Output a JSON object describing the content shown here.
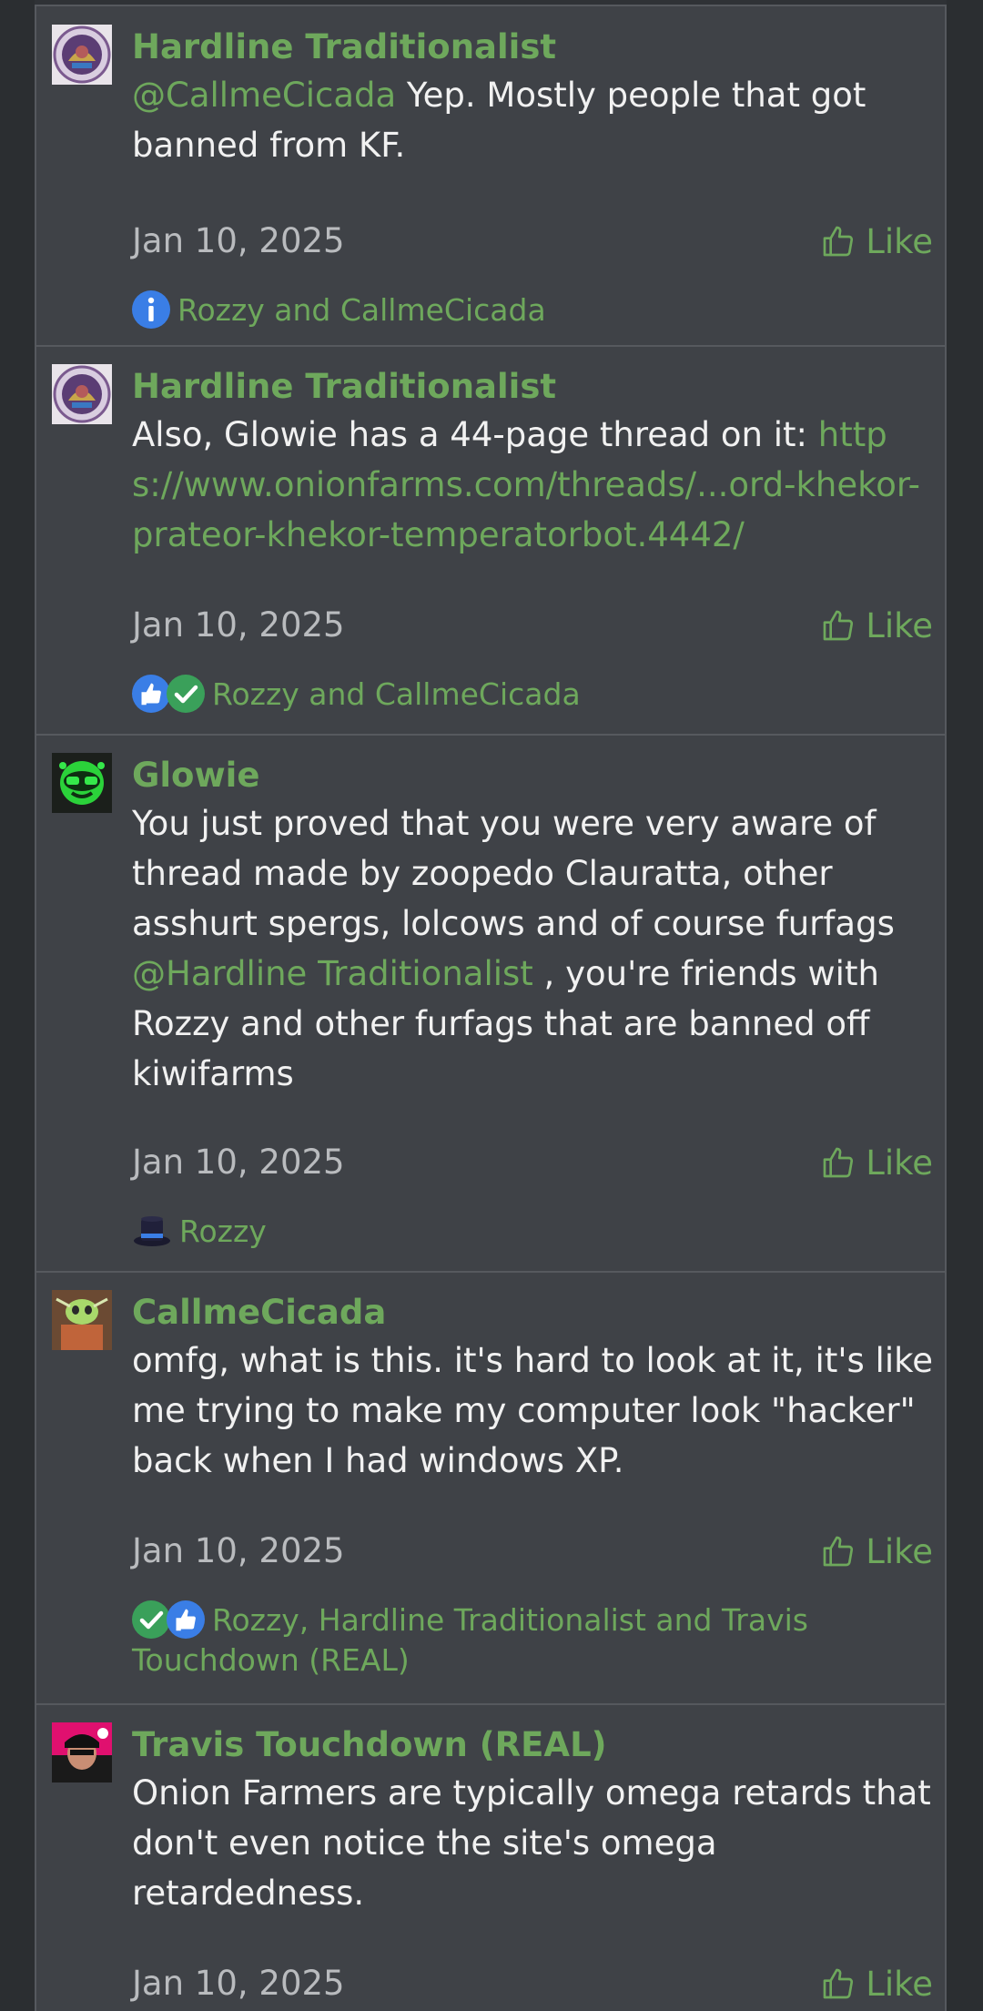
{
  "colors": {
    "background": "#2f3236",
    "post_bg": "#3f4247",
    "accent": "#6ea85c",
    "travis": "#6ea85c",
    "text": "#f1f1f1",
    "muted": "#b9bbbe"
  },
  "posts": [
    {
      "username": "Hardline Traditionalist",
      "avatar_icon": "seal-avatar",
      "body": {
        "mention": "@CallmeCicada",
        "text": " Yep. Mostly people that got banned from KF."
      },
      "date": "Jan 10, 2025",
      "like_label": "Like",
      "reaction_icons": [
        "info-icon"
      ],
      "reactions": "Rozzy and CallmeCicada"
    },
    {
      "username": "Hardline Traditionalist",
      "avatar_icon": "seal-avatar",
      "body": {
        "text": "Also, Glowie has a 44-page thread on it: ",
        "link": "https://www.onionfarms.com/threads/...ord-khekor-prateor-khekor-temperatorbot.4442/"
      },
      "date": "Jan 10, 2025",
      "like_label": "Like",
      "reaction_icons": [
        "thumbs-up-icon",
        "check-icon"
      ],
      "reactions": "Rozzy and CallmeCicada"
    },
    {
      "username": "Glowie",
      "avatar_icon": "green-glow-avatar",
      "body": {
        "text": "You just proved that you were very aware of thread made by zoopedo Clauratta, other asshurt spergs, lolcows and of course furfags ",
        "mention": "@Hardline Traditionalist",
        "text2": " , you're friends with Rozzy and other furfags that are banned off kiwifarms"
      },
      "date": "Jan 10, 2025",
      "like_label": "Like",
      "reaction_icons": [
        "top-hat-icon"
      ],
      "reactions": "Rozzy"
    },
    {
      "username": "CallmeCicada",
      "avatar_icon": "cicada-avatar",
      "body": {
        "text": "omfg, what is this. it's hard to look at it, it's like me trying to make my computer look \"hacker\" back when I had windows XP."
      },
      "date": "Jan 10, 2025",
      "like_label": "Like",
      "reaction_icons": [
        "check-icon",
        "thumbs-up-icon"
      ],
      "reactions": "Rozzy, Hardline Traditionalist and Travis Touchdown (REAL)"
    },
    {
      "username": "Travis Touchdown (REAL)",
      "avatar_icon": "travis-avatar",
      "body": {
        "text": "Onion Farmers are typically omega retards that don't even notice the site's omega retardedness."
      },
      "date": "Jan 10, 2025",
      "like_label": "Like"
    }
  ]
}
